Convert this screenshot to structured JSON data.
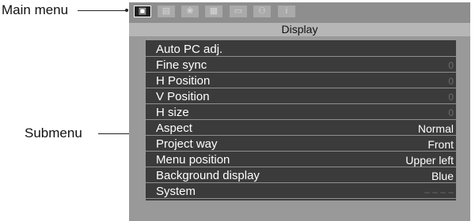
{
  "annotations": {
    "main_menu": "Main menu",
    "submenu": "Submenu"
  },
  "tabs": [
    {
      "icon": "display-icon",
      "glyph": "▣",
      "active": true
    },
    {
      "icon": "picture-icon",
      "glyph": "▤",
      "active": false
    },
    {
      "icon": "color-icon",
      "glyph": "❀",
      "active": false
    },
    {
      "icon": "input-icon",
      "glyph": "▦",
      "active": false
    },
    {
      "icon": "screen-icon",
      "glyph": "▭",
      "active": false
    },
    {
      "icon": "network-icon",
      "glyph": "⚇",
      "active": false
    },
    {
      "icon": "info-icon",
      "glyph": "i",
      "active": false
    }
  ],
  "menu": {
    "title": "Display",
    "items": [
      {
        "label": "Auto PC adj.",
        "value": ""
      },
      {
        "label": "Fine sync",
        "value": "0",
        "dim": true
      },
      {
        "label": "H Position",
        "value": "0",
        "dim": true
      },
      {
        "label": "V Position",
        "value": "0",
        "dim": true
      },
      {
        "label": "H size",
        "value": "0",
        "dim": true
      },
      {
        "label": "Aspect",
        "value": "Normal"
      },
      {
        "label": "Project way",
        "value": "Front"
      },
      {
        "label": "Menu position",
        "value": "Upper left"
      },
      {
        "label": "Background display",
        "value": "Blue"
      },
      {
        "label": "System",
        "value": "– – – –",
        "dim": true
      }
    ]
  },
  "colors": {
    "frame": "#999999",
    "list_bg": "#3b3b3b",
    "tab_active": "#1f1f1f",
    "dim_value": "#6c6c6c"
  }
}
